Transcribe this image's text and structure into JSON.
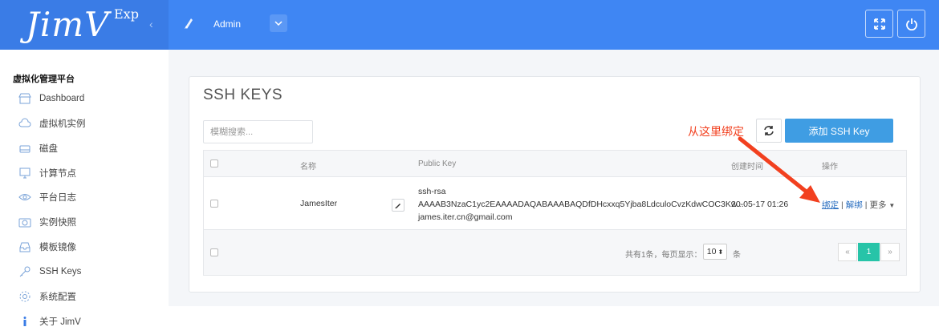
{
  "header": {
    "logo": "JimV",
    "edition": "Exp",
    "collapse": "‹",
    "user": "Admin",
    "user_dropdown": "⌄"
  },
  "sidebar": {
    "title": "虚拟化管理平台",
    "items": [
      {
        "label": "Dashboard",
        "icon": "store-icon"
      },
      {
        "label": "虚拟机实例",
        "icon": "cloud-icon"
      },
      {
        "label": "磁盘",
        "icon": "disk-icon"
      },
      {
        "label": "计算节点",
        "icon": "monitor-icon"
      },
      {
        "label": "平台日志",
        "icon": "eye-icon"
      },
      {
        "label": "实例快照",
        "icon": "camera-icon"
      },
      {
        "label": "模板镜像",
        "icon": "inbox-icon"
      },
      {
        "label": "SSH Keys",
        "icon": "key-icon"
      },
      {
        "label": "系统配置",
        "icon": "gear-icon"
      },
      {
        "label": "关于 JimV",
        "icon": "info-icon"
      }
    ]
  },
  "page": {
    "title": "SSH KEYS",
    "search_placeholder": "模糊搜索...",
    "annotation": "从这里绑定",
    "add_button": "添加 SSH Key"
  },
  "table": {
    "headers": {
      "name": "名称",
      "public_key": "Public Key",
      "created": "创建时间",
      "actions": "操作"
    },
    "rows": [
      {
        "name": "JamesIter",
        "key_type": "ssh-rsa",
        "key_body": "AAAAB3NzaC1yc2EAAAADAQABAAABAQDfDHcxxq5Yjba8LdculoCvzKdwCOC3Kw...",
        "key_comment": "james.iter.cn@gmail.com",
        "created": "20-05-17 01:26",
        "action_bind": "绑定",
        "action_unbind": "解绑",
        "action_more": "更多"
      }
    ]
  },
  "pagination": {
    "info": "共有1条，每页显示：",
    "page_size": "10",
    "unit": "条",
    "prev": "«",
    "current": "1",
    "next": "»"
  },
  "colors": {
    "header": "#3f86f3",
    "primary_button": "#3f9de3",
    "annotation": "#f2401f",
    "active_page": "#27c4a8"
  }
}
